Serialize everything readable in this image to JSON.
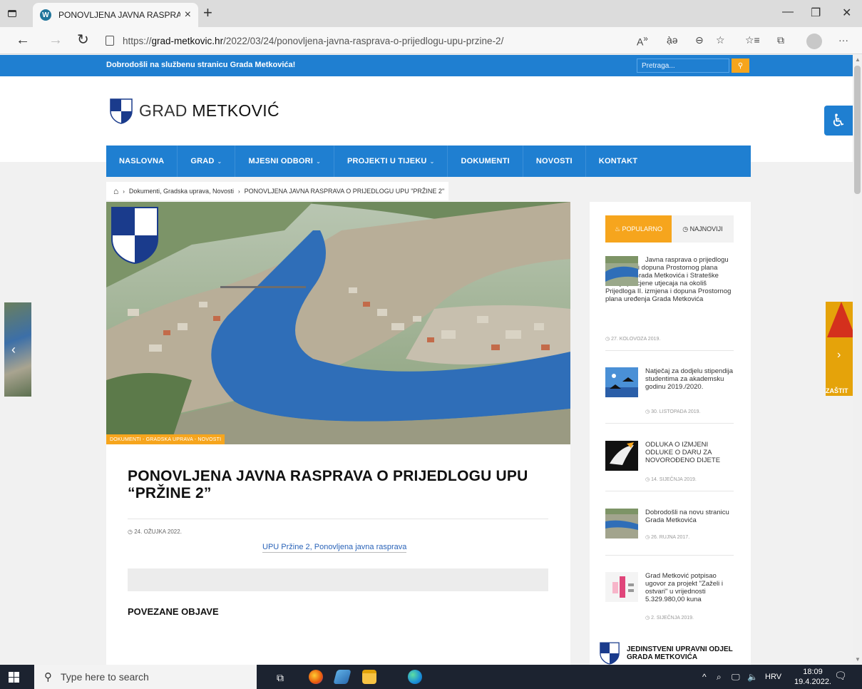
{
  "browser": {
    "tab_title": "PONOVLJENA JAVNA RASPRAVA",
    "tab_close": "×",
    "new_tab": "+",
    "url_prefix": "https://",
    "url_domain": "grad-metkovic.hr",
    "url_path": "/2022/03/24/ponovljena-javna-rasprava-o-prijedlogu-upu-przine-2/",
    "minimize": "—",
    "restore": "❐",
    "close": "✕",
    "more": "···"
  },
  "topbar": {
    "welcome": "Dobrodošli na službenu stranicu Grada Metkovića!",
    "search_placeholder": "Pretraga..."
  },
  "site": {
    "name_thin": "GRAD ",
    "name_bold": "METKOVIĆ"
  },
  "nav": {
    "items": [
      {
        "label": "NASLOVNA",
        "dropdown": false
      },
      {
        "label": "GRAD",
        "dropdown": true
      },
      {
        "label": "MJESNI ODBORI",
        "dropdown": true
      },
      {
        "label": "PROJEKTI U TIJEKU",
        "dropdown": true
      },
      {
        "label": "DOKUMENTI",
        "dropdown": false
      },
      {
        "label": "NOVOSTI",
        "dropdown": false
      },
      {
        "label": "KONTAKT",
        "dropdown": false
      }
    ]
  },
  "breadcrumb": {
    "categories": "Dokumenti, Gradska uprava, Novosti",
    "current": "PONOVLJENA JAVNA RASPRAVA O PRIJEDLOGU UPU \"PRŽINE 2\""
  },
  "article": {
    "category_badge": "DOKUMENTI - GRADSKA UPRAVA - NOVOSTI",
    "title": "PONOVLJENA JAVNA RASPRAVA O PRIJEDLOGU UPU “PRŽINE 2”",
    "date": "24. OŽUJKA 2022.",
    "tags": "UPU Pržine 2, Ponovljena javna rasprava",
    "related_heading": "POVEZANE OBJAVE"
  },
  "sidebar": {
    "tab_popular": "POPULARNO",
    "tab_newest": "NAJNOVIJI",
    "posts": [
      {
        "title": "Javna rasprava o prijedlogu II. izmjena i dopuna Prostornog plana uređenja Grada Metkovića i Strateške studije procjene utjecaja na okoliš Prijedloga II. izmjena i dopuna Prostornog plana uređenja Grada Metkovića",
        "date": "27. KOLOVOZA 2019."
      },
      {
        "title": "Natječaj za dodjelu stipendija studentima za akademsku godinu 2019./2020.",
        "date": "30. LISTOPADA 2019."
      },
      {
        "title": "ODLUKA O IZMJENI ODLUKE O DARU ZA NOVOROĐENO DIJETE",
        "date": "14. SIJEČNJA 2019."
      },
      {
        "title": "Dobrodošli na novu stranicu Grada Metkovića",
        "date": "26. RUJNA 2017."
      },
      {
        "title": "Grad Metković potpisao ugovor za projekt \"Zaželi i ostvari\" u vrijednosti 5.329.980,00 kuna",
        "date": "2. SIJEČNJA 2019."
      }
    ],
    "juo_line1": "JEDINSTVENI UPRAVNI ODJEL",
    "juo_line2": "GRADA METKOVIĆA"
  },
  "side_banner": {
    "right_label": "ZAŠTIT"
  },
  "taskbar": {
    "search_placeholder": "Type here to search",
    "lang": "HRV",
    "time": "18:09",
    "date": "19.4.2022."
  },
  "colors": {
    "brand_blue": "#1f7fd1",
    "accent_orange": "#f6a51d"
  }
}
